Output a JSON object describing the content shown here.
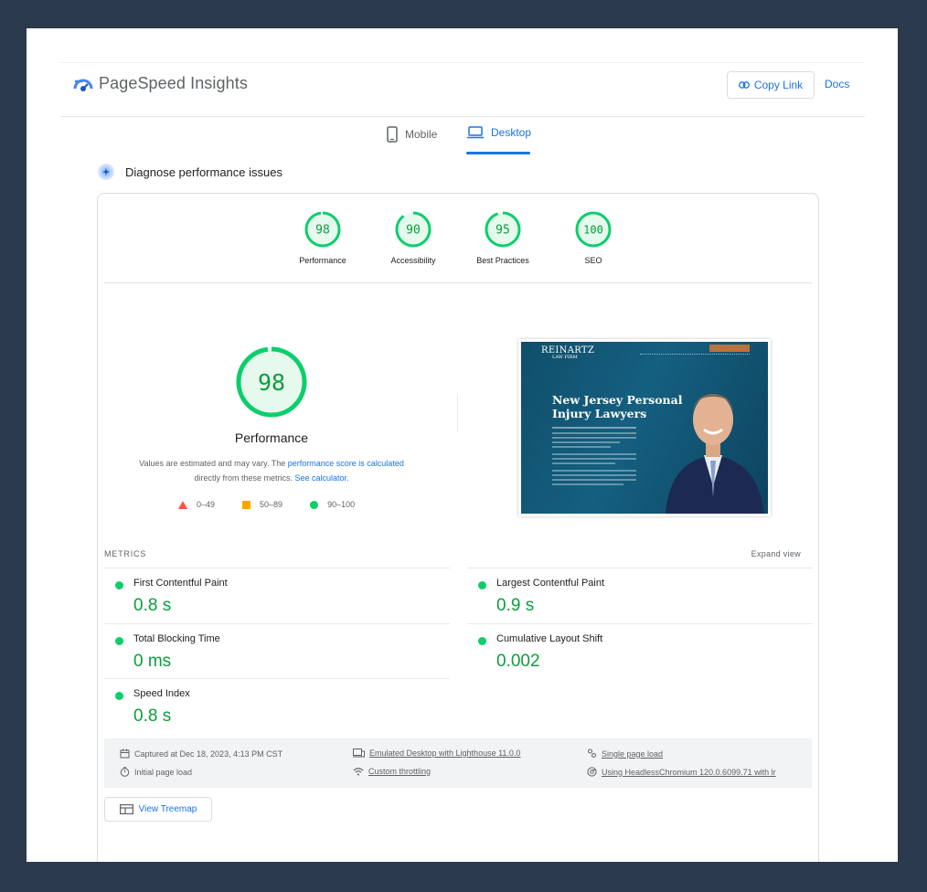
{
  "header": {
    "brand": "PageSpeed Insights",
    "copy_link": "Copy Link",
    "docs": "Docs"
  },
  "tabs": [
    {
      "label": "Mobile",
      "icon": "phone-icon",
      "active": false
    },
    {
      "label": "Desktop",
      "icon": "laptop-icon",
      "active": true
    }
  ],
  "diagnose": {
    "title": "Diagnose performance issues"
  },
  "scores": [
    {
      "label": "Performance",
      "value": "98",
      "fraction": 0.98
    },
    {
      "label": "Accessibility",
      "value": "90",
      "fraction": 0.9
    },
    {
      "label": "Best Practices",
      "value": "95",
      "fraction": 0.95
    },
    {
      "label": "SEO",
      "value": "100",
      "fraction": 1.0
    }
  ],
  "main_score": {
    "value": "98",
    "label": "Performance",
    "fraction": 0.98
  },
  "note": {
    "part1": "Values are estimated and may vary. The ",
    "link1": "performance score is calculated",
    "part2": "directly from these metrics. ",
    "link2": "See calculator."
  },
  "legend": [
    {
      "range": "0–49",
      "color": "#ff4e42",
      "shape": "triangle"
    },
    {
      "range": "50–89",
      "color": "#ffa400",
      "shape": "square"
    },
    {
      "range": "90–100",
      "color": "#0cce6b",
      "shape": "circle"
    }
  ],
  "screenshot": {
    "logo_main": "REINARTZ",
    "logo_sub": "LAW FIRM",
    "headline_1": "New Jersey Personal",
    "headline_2": "Injury Lawyers"
  },
  "metrics": {
    "heading": "METRICS",
    "expand": "Expand view",
    "items": [
      {
        "name": "First Contentful Paint",
        "value": "0.8 s"
      },
      {
        "name": "Largest Contentful Paint",
        "value": "0.9 s"
      },
      {
        "name": "Total Blocking Time",
        "value": "0 ms"
      },
      {
        "name": "Cumulative Layout Shift",
        "value": "0.002"
      },
      {
        "name": "Speed Index",
        "value": "0.8 s"
      }
    ]
  },
  "info": {
    "captured": "Captured at Dec 18, 2023, 4:13 PM CST",
    "initial": "Initial page load",
    "emulated": "Emulated Desktop with Lighthouse 11.0.0",
    "throttling": "Custom throttling",
    "single": "Single page load",
    "browser": "Using HeadlessChromium 120.0.6099.71 with lr"
  },
  "treemap": {
    "label": "View Treemap"
  },
  "colors": {
    "accent": "#1a73e8",
    "good": "#0cce6b",
    "good_text": "#0c9d3e",
    "gauge_fill": "#e6f9ed"
  }
}
